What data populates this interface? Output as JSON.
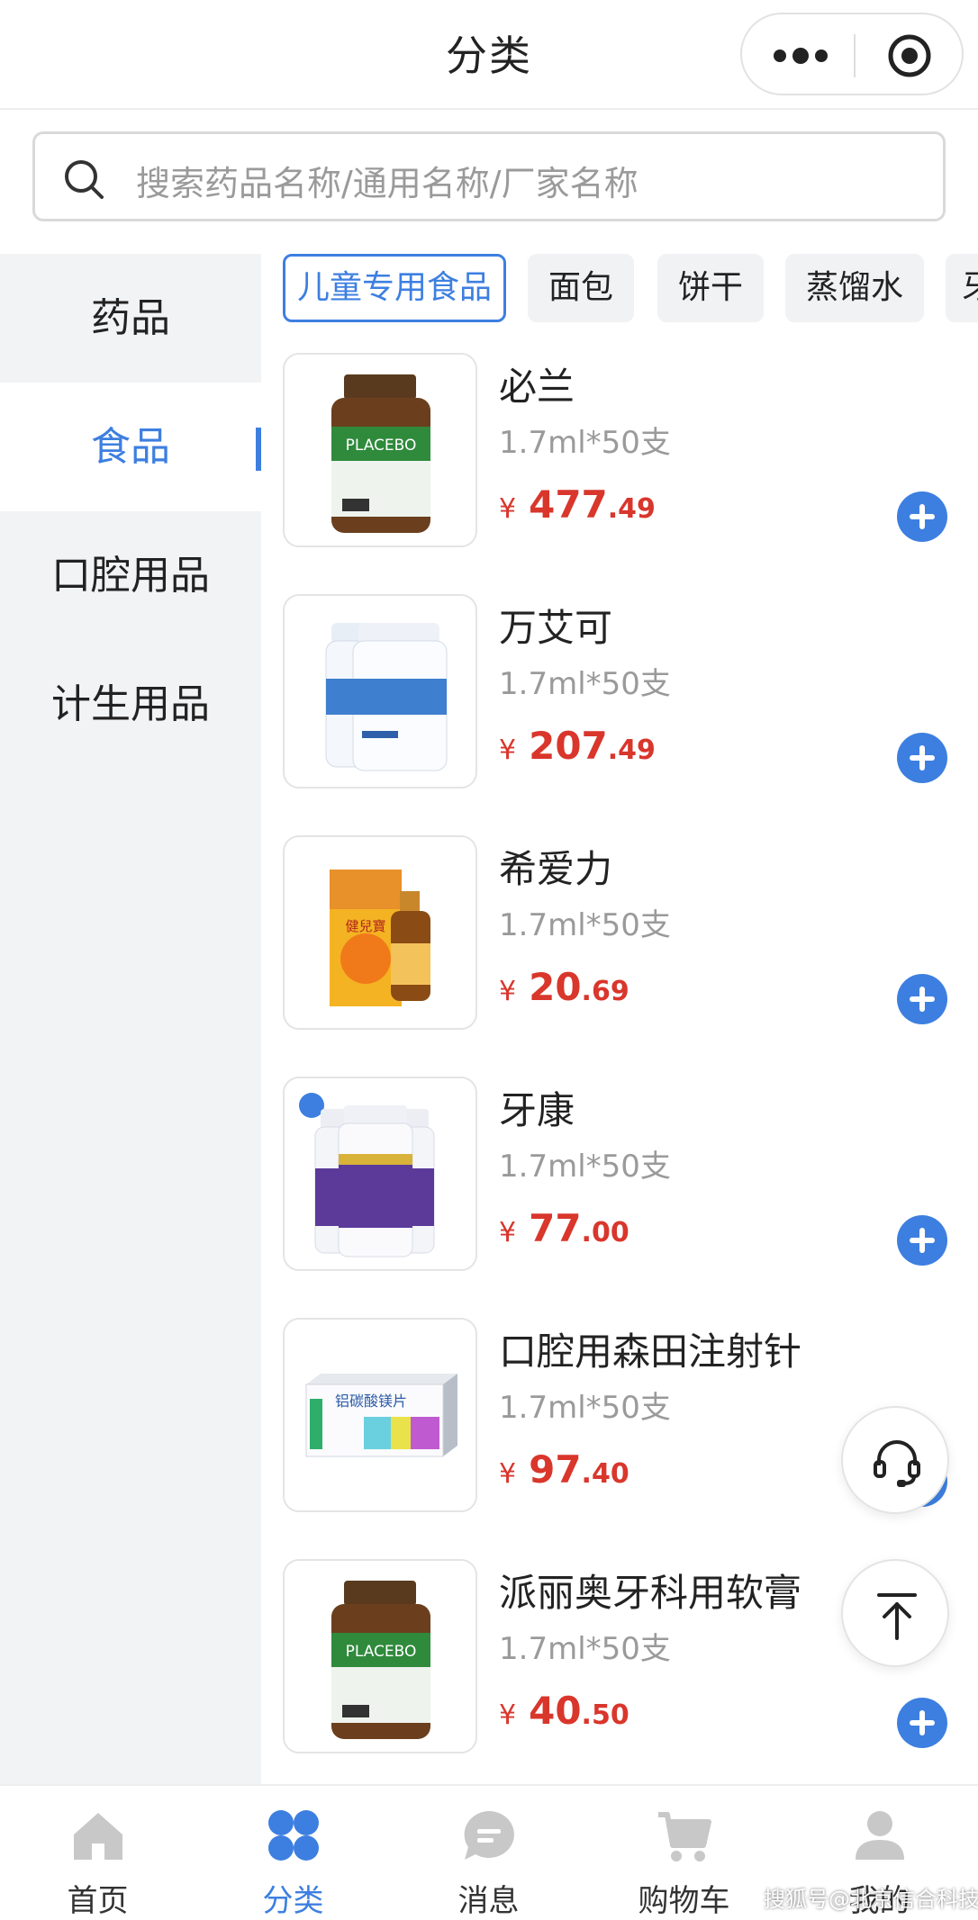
{
  "header": {
    "title": "分类"
  },
  "search": {
    "placeholder": "搜索药品名称/通用名称/厂家名称"
  },
  "sidebar": {
    "items": [
      {
        "label": "药品"
      },
      {
        "label": "食品",
        "active": true
      },
      {
        "label": "口腔用品"
      },
      {
        "label": "计生用品"
      }
    ]
  },
  "tabs": [
    {
      "label": "儿童专用食品",
      "active": true
    },
    {
      "label": "面包"
    },
    {
      "label": "饼干"
    },
    {
      "label": "蒸馏水"
    },
    {
      "label": "牙"
    }
  ],
  "products": [
    {
      "name": "必兰",
      "spec": "1.7ml*50支",
      "currency": "¥",
      "price_int": "477",
      "price_dec": ".49"
    },
    {
      "name": "万艾可",
      "spec": "1.7ml*50支",
      "currency": "¥",
      "price_int": "207",
      "price_dec": ".49"
    },
    {
      "name": "希爱力",
      "spec": "1.7ml*50支",
      "currency": "¥",
      "price_int": "20",
      "price_dec": ".69"
    },
    {
      "name": "牙康",
      "spec": "1.7ml*50支",
      "currency": "¥",
      "price_int": "77",
      "price_dec": ".00"
    },
    {
      "name": "口腔用森田注射针",
      "spec": "1.7ml*50支",
      "currency": "¥",
      "price_int": "97",
      "price_dec": ".40"
    },
    {
      "name": "派丽奥牙科用软膏",
      "spec": "1.7ml*50支",
      "currency": "¥",
      "price_int": "40",
      "price_dec": ".50"
    }
  ],
  "product_images": {
    "placebo_label": "PLACEBO",
    "box_label": "铝碳酸镁片",
    "syrup_label": "健兒寶"
  },
  "tabbar": {
    "items": [
      {
        "label": "首页",
        "icon": "home-icon"
      },
      {
        "label": "分类",
        "icon": "category-icon",
        "active": true
      },
      {
        "label": "消息",
        "icon": "message-icon"
      },
      {
        "label": "购物车",
        "icon": "cart-icon"
      },
      {
        "label": "我的",
        "icon": "user-icon"
      }
    ]
  },
  "watermark": "搜狐号@北京信合科技",
  "colors": {
    "accent": "#3d7fe0",
    "price": "#d9362c",
    "sidebar_bg": "#f2f3f5"
  }
}
